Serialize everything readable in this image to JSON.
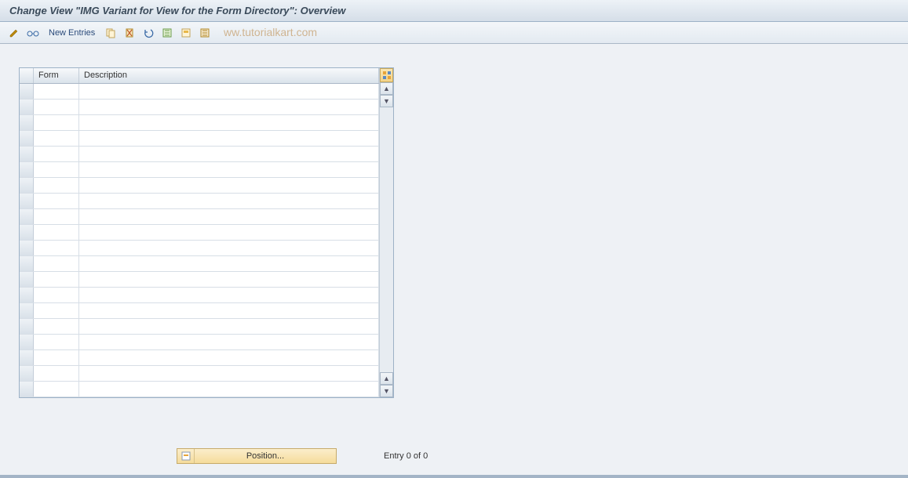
{
  "header": {
    "title": "Change View \"IMG Variant for View for the Form Directory\": Overview"
  },
  "toolbar": {
    "new_entries_label": "New Entries"
  },
  "watermark": "ww.tutorialkart.com",
  "table": {
    "columns": {
      "form": "Form",
      "description": "Description"
    },
    "rows": [
      {
        "form": "",
        "description": ""
      },
      {
        "form": "",
        "description": ""
      },
      {
        "form": "",
        "description": ""
      },
      {
        "form": "",
        "description": ""
      },
      {
        "form": "",
        "description": ""
      },
      {
        "form": "",
        "description": ""
      },
      {
        "form": "",
        "description": ""
      },
      {
        "form": "",
        "description": ""
      },
      {
        "form": "",
        "description": ""
      },
      {
        "form": "",
        "description": ""
      },
      {
        "form": "",
        "description": ""
      },
      {
        "form": "",
        "description": ""
      },
      {
        "form": "",
        "description": ""
      },
      {
        "form": "",
        "description": ""
      },
      {
        "form": "",
        "description": ""
      },
      {
        "form": "",
        "description": ""
      },
      {
        "form": "",
        "description": ""
      },
      {
        "form": "",
        "description": ""
      },
      {
        "form": "",
        "description": ""
      },
      {
        "form": "",
        "description": ""
      }
    ]
  },
  "footer": {
    "position_label": "Position...",
    "entry_text": "Entry 0 of 0"
  }
}
